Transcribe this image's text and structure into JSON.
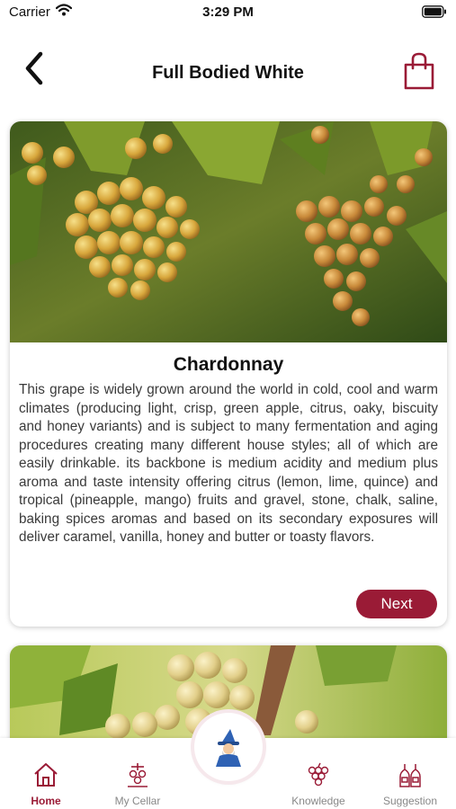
{
  "status_bar": {
    "carrier": "Carrier",
    "time": "3:29 PM"
  },
  "header": {
    "title": "Full Bodied White",
    "back_icon": "chevron-left-icon",
    "cart_icon": "shopping-bag-icon"
  },
  "cards": [
    {
      "title": "Chardonnay",
      "description": "This grape is widely grown around the world in cold, cool and warm climates (producing light, crisp, green apple, citrus, oaky, biscuity and honey variants) and is subject to many fermentation and aging procedures creating many different house styles; all of which are easily drinkable. its backbone is medium acidity and medium plus aroma and taste intensity offering citrus (lemon, lime, quince) and tropical (pineapple, mango) fruits and gravel, stone, chalk, saline, baking spices aromas and based on its secondary exposures will deliver caramel, vanilla, honey and butter or toasty flavors.",
      "next_label": "Next"
    }
  ],
  "tab_bar": {
    "items": [
      {
        "label": "Home",
        "icon": "home-icon",
        "active": true
      },
      {
        "label": "My Cellar",
        "icon": "cellar-icon",
        "active": false
      },
      {
        "label": "Knowledge",
        "icon": "grapes-icon",
        "active": false
      },
      {
        "label": "Suggestion",
        "icon": "wine-bottles-icon",
        "active": false
      }
    ],
    "center_icon": "wizard-icon"
  },
  "colors": {
    "accent": "#9a1b36",
    "inactive": "#888888",
    "background": "#ffffff"
  }
}
